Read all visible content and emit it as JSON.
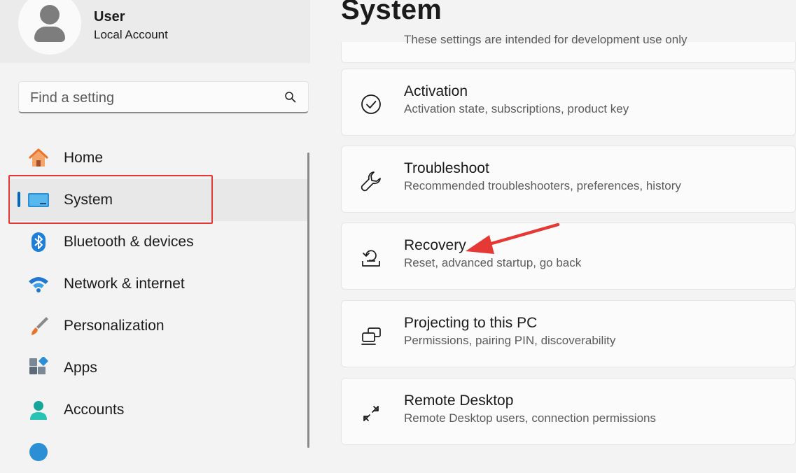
{
  "user": {
    "name": "User",
    "account_type": "Local Account"
  },
  "search": {
    "placeholder": "Find a setting"
  },
  "nav": {
    "items": [
      {
        "label": "Home"
      },
      {
        "label": "System"
      },
      {
        "label": "Bluetooth & devices"
      },
      {
        "label": "Network & internet"
      },
      {
        "label": "Personalization"
      },
      {
        "label": "Apps"
      },
      {
        "label": "Accounts"
      }
    ],
    "selected": "System"
  },
  "main": {
    "title": "System",
    "partial_card_text": "These settings are intended for development use only",
    "cards": [
      {
        "title": "Activation",
        "subtitle": "Activation state, subscriptions, product key",
        "icon": "activation-check-icon"
      },
      {
        "title": "Troubleshoot",
        "subtitle": "Recommended troubleshooters, preferences, history",
        "icon": "wrench-icon"
      },
      {
        "title": "Recovery",
        "subtitle": "Reset, advanced startup, go back",
        "icon": "recovery-icon"
      },
      {
        "title": "Projecting to this PC",
        "subtitle": "Permissions, pairing PIN, discoverability",
        "icon": "projecting-icon"
      },
      {
        "title": "Remote Desktop",
        "subtitle": "Remote Desktop users, connection permissions",
        "icon": "remote-desktop-icon"
      }
    ]
  },
  "colors": {
    "accent": "#0067c0",
    "annotation": "#e53935"
  }
}
